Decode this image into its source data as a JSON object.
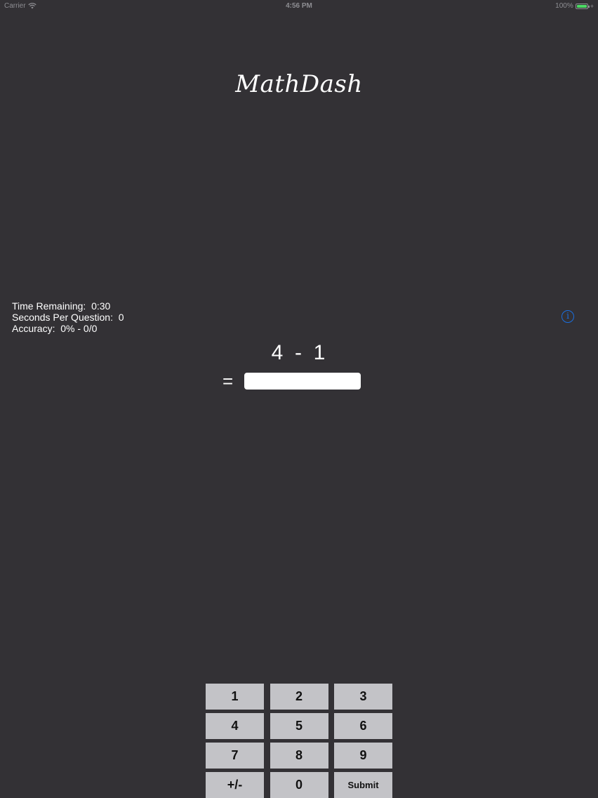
{
  "status_bar": {
    "carrier": "Carrier",
    "time": "4:56 PM",
    "battery": "100%"
  },
  "app": {
    "title": "MathDash"
  },
  "stats": {
    "time_remaining": "Time Remaining:  0:30",
    "seconds_per_question": "Seconds Per Question:  0",
    "accuracy": "Accuracy:  0% - 0/0"
  },
  "info_button": {
    "icon": "info-icon",
    "label": "i",
    "color": "#1a6fe0"
  },
  "question": {
    "expression": "4  -  1",
    "equals": "="
  },
  "answer": {
    "value": "",
    "placeholder": ""
  },
  "keypad": {
    "keys": [
      "1",
      "2",
      "3",
      "4",
      "5",
      "6",
      "7",
      "8",
      "9",
      "+/-",
      "0",
      "Submit"
    ]
  },
  "colors": {
    "background": "#333135",
    "key_background": "#c3c3c7",
    "battery_fill": "#4cd964"
  }
}
